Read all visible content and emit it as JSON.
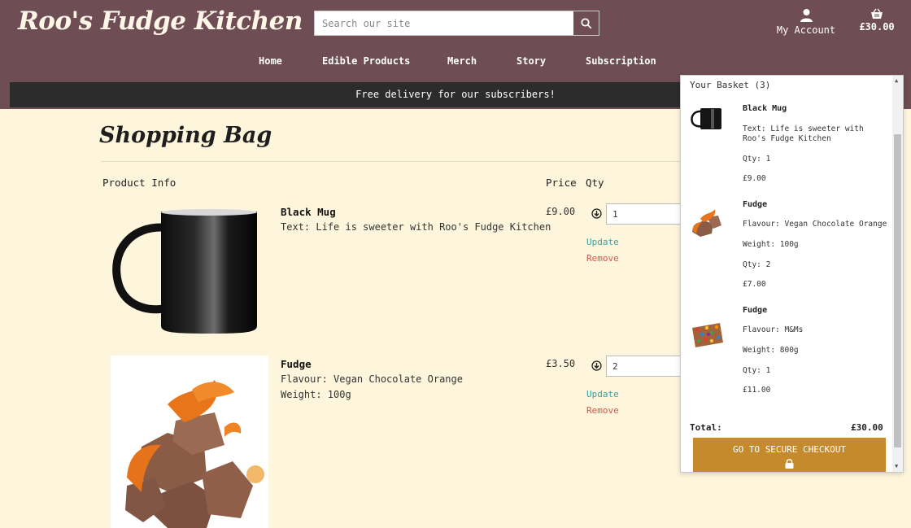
{
  "header": {
    "logo": "Roo's Fudge Kitchen",
    "search_placeholder": "Search our site",
    "account_label": "My Account",
    "cart_total": "£30.00",
    "brand_color": "#6e4d54"
  },
  "nav": {
    "items": [
      {
        "label": "Home"
      },
      {
        "label": "Edible Products"
      },
      {
        "label": "Merch"
      },
      {
        "label": "Story"
      },
      {
        "label": "Subscription"
      }
    ]
  },
  "banner": {
    "text": "Free delivery for our subscribers!"
  },
  "bag": {
    "title": "Shopping Bag",
    "headers": {
      "product": "Product Info",
      "price": "Price",
      "qty": "Qty"
    },
    "items": [
      {
        "name": "Black Mug",
        "details": [
          "Text: Life is sweeter with Roo's Fudge Kitchen"
        ],
        "price": "£9.00",
        "qty": "1",
        "update": "Update",
        "remove": "Remove"
      },
      {
        "name": "Fudge",
        "details": [
          "Flavour: Vegan Chocolate Orange",
          "Weight: 100g"
        ],
        "price": "£3.50",
        "qty": "2",
        "update": "Update",
        "remove": "Remove"
      }
    ]
  },
  "basket": {
    "heading": "Your Basket (3)",
    "items": [
      {
        "name": "Black Mug",
        "lines": [
          "Text: Life is sweeter with Roo's Fudge Kitchen",
          "Qty: 1",
          "£9.00"
        ]
      },
      {
        "name": "Fudge",
        "lines": [
          "Flavour: Vegan Chocolate Orange",
          "Weight: 100g",
          "Qty: 2",
          "£7.00"
        ]
      },
      {
        "name": "Fudge",
        "lines": [
          "Flavour: M&Ms",
          "Weight: 800g",
          "Qty: 1",
          "£11.00"
        ]
      }
    ],
    "total_label": "Total:",
    "total_value": "£30.00",
    "checkout_label": "GO TO SECURE CHECKOUT",
    "accent_color": "#c58a2c"
  }
}
